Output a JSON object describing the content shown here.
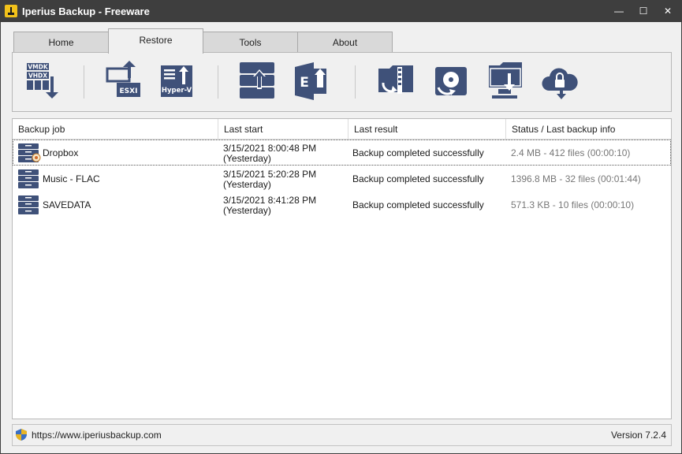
{
  "window": {
    "title": "Iperius Backup - Freeware",
    "controls": {
      "minimize": "—",
      "maximize": "☐",
      "close": "✕"
    }
  },
  "tabs": [
    {
      "label": "Home",
      "active": false
    },
    {
      "label": "Restore",
      "active": true
    },
    {
      "label": "Tools",
      "active": false
    },
    {
      "label": "About",
      "active": false
    }
  ],
  "toolbar": {
    "accent_color": "#3f5179",
    "buttons": [
      {
        "name": "restore-vmdk-vhdx",
        "icon": "vmdk-vhdx-restore-icon",
        "labels": [
          "VMDK",
          "VHDX"
        ]
      },
      {
        "name": "restore-esxi",
        "icon": "esxi-restore-icon",
        "labels": [
          "ESXI"
        ]
      },
      {
        "name": "restore-hyperv",
        "icon": "hyperv-restore-icon",
        "labels": [
          "Hyper-V"
        ]
      },
      {
        "name": "restore-database",
        "icon": "database-server-restore-icon",
        "labels": []
      },
      {
        "name": "restore-exchange",
        "icon": "exchange-restore-icon",
        "labels": []
      },
      {
        "name": "restore-zip",
        "icon": "zip-folder-restore-icon",
        "labels": []
      },
      {
        "name": "restore-disk-image",
        "icon": "disk-image-restore-icon",
        "labels": []
      },
      {
        "name": "restore-network",
        "icon": "network-folder-restore-icon",
        "labels": []
      },
      {
        "name": "restore-cloud",
        "icon": "cloud-restore-icon",
        "labels": []
      }
    ]
  },
  "list": {
    "columns": [
      "Backup job",
      "Last start",
      "Last result",
      "Status / Last backup info"
    ],
    "rows": [
      {
        "job": "Dropbox",
        "start_time": "3/15/2021 8:00:48 PM",
        "start_day": "(Yesterday)",
        "result": "Backup completed successfully",
        "status": "2.4 MB - 412 files (00:00:10)",
        "selected": true,
        "badge": true
      },
      {
        "job": "Music - FLAC",
        "start_time": "3/15/2021 5:20:28 PM",
        "start_day": "(Yesterday)",
        "result": "Backup completed successfully",
        "status": "1396.8 MB - 32 files (00:01:44)",
        "selected": false,
        "badge": false
      },
      {
        "job": "SAVEDATA",
        "start_time": "3/15/2021 8:41:28 PM",
        "start_day": "(Yesterday)",
        "result": "Backup completed successfully",
        "status": "571.3 KB - 10 files (00:00:10)",
        "selected": false,
        "badge": false
      }
    ]
  },
  "statusbar": {
    "url": "https://www.iperiusbackup.com",
    "version": "Version 7.2.4"
  }
}
